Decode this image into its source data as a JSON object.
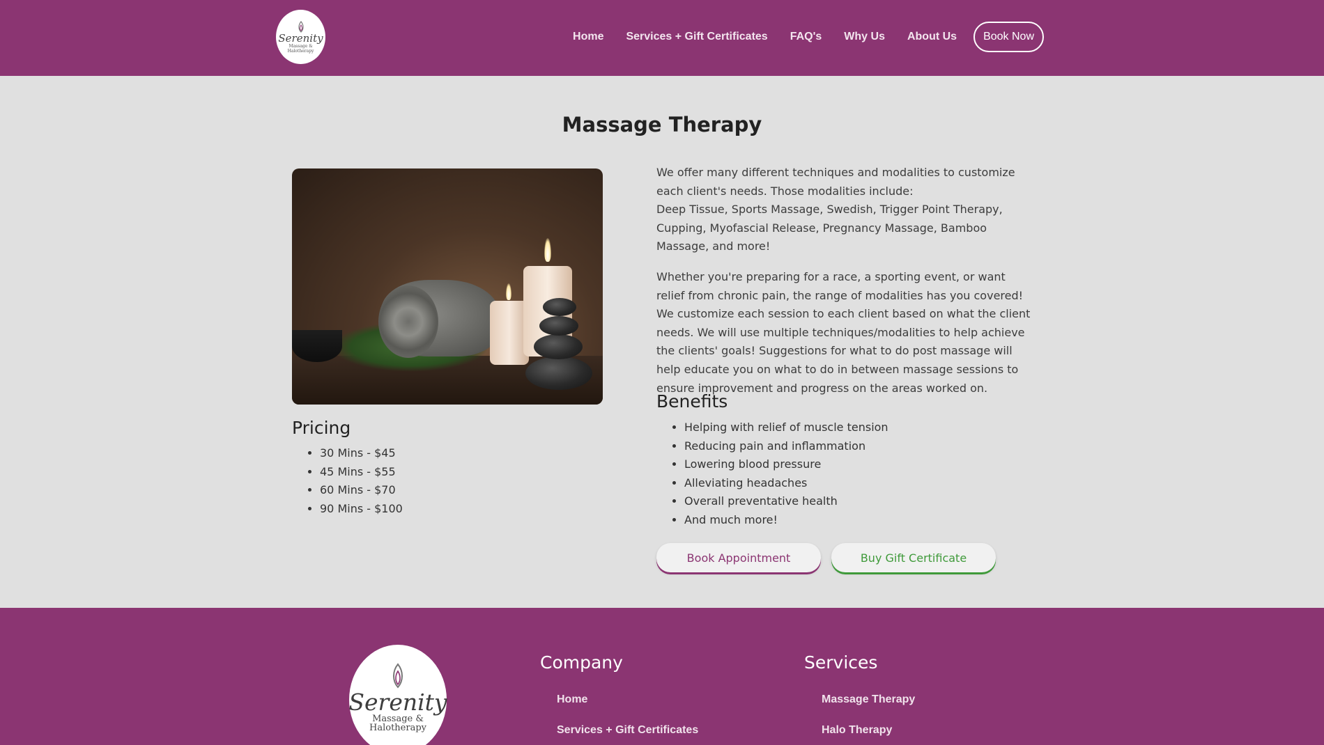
{
  "header": {
    "logo": {
      "brand": "Serenity",
      "sub1": "Massage &",
      "sub2": "Halotherapy"
    },
    "nav": [
      {
        "label": "Home"
      },
      {
        "label": "Services + Gift Certificates"
      },
      {
        "label": "FAQ's"
      },
      {
        "label": "Why Us"
      },
      {
        "label": "About Us"
      }
    ],
    "book_now": "Book Now"
  },
  "main": {
    "title": "Massage Therapy",
    "intro_1": "We offer many different techniques and modalities to customize each client's needs. Those modalities include:",
    "intro_2": "Deep Tissue, Sports Massage, Swedish, Trigger Point Therapy, Cupping, Myofascial Release, Pregnancy Massage, Bamboo Massage, and more!",
    "paragraph": "Whether you're preparing for a race, a sporting event, or want relief from chronic pain, the range of modalities has you covered! We customize each session to each client based on what the client needs. We will use multiple techniques/modalities to help achieve the clients' goals! Suggestions for what to do post massage will help educate you on what to do in between massage sessions to ensure improvement and progress on the areas worked on.",
    "pricing_heading": "Pricing",
    "pricing": [
      "30 Mins - $45",
      "45 Mins - $55",
      "60 Mins - $70",
      "90 Mins - $100"
    ],
    "benefits_heading": "Benefits",
    "benefits": [
      "Helping with relief of muscle tension",
      "Reducing pain and inflammation",
      "Lowering blood pressure",
      "Alleviating headaches",
      "Overall preventative health",
      "And much more!"
    ],
    "book_appointment": "Book Appointment",
    "buy_gift": "Buy Gift Certificate"
  },
  "footer": {
    "logo": {
      "brand": "Serenity",
      "sub1": "Massage &",
      "sub2": "Halotherapy"
    },
    "company_heading": "Company",
    "company_links": [
      "Home",
      "Services + Gift Certificates"
    ],
    "services_heading": "Services",
    "services_links": [
      "Massage Therapy",
      "Halo Therapy"
    ]
  },
  "colors": {
    "brand": "#8b3572",
    "background": "#e0e0e0",
    "gift_green": "#3f9a3a"
  }
}
